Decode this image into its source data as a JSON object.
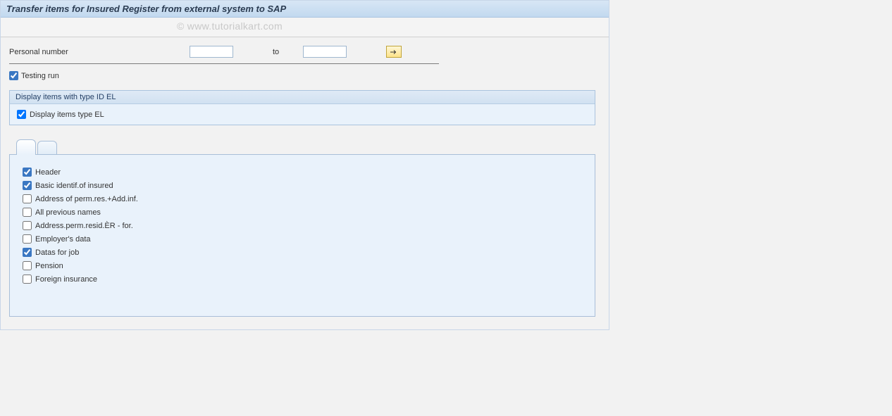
{
  "header": {
    "title": "Transfer items for Insured Register from external system to SAP"
  },
  "watermark": "© www.tutorialkart.com",
  "selection": {
    "personal_number_label": "Personal number",
    "personal_number_from": "",
    "to_label": "to",
    "personal_number_to": "",
    "multi_select_icon": "arrow-right-icon"
  },
  "testing_run": {
    "label": "Testing run",
    "checked": true
  },
  "group_el": {
    "title": "Display items with type ID EL",
    "checkbox_label": "Display items type EL",
    "checked": true
  },
  "tabs": {
    "active_index": 0,
    "items": [
      {
        "label": ""
      },
      {
        "label": ""
      }
    ],
    "panel_checks": [
      {
        "label": "Header",
        "checked": true
      },
      {
        "label": "Basic identif.of insured",
        "checked": true
      },
      {
        "label": "Address of perm.res.+Add.inf.",
        "checked": false
      },
      {
        "label": "All previous names",
        "checked": false
      },
      {
        "label": "Address.perm.resid.ÈR - for.",
        "checked": false
      },
      {
        "label": "Employer's data",
        "checked": false
      },
      {
        "label": "Datas for job",
        "checked": true
      },
      {
        "label": "Pension",
        "checked": false
      },
      {
        "label": "Foreign insurance",
        "checked": false
      }
    ]
  }
}
